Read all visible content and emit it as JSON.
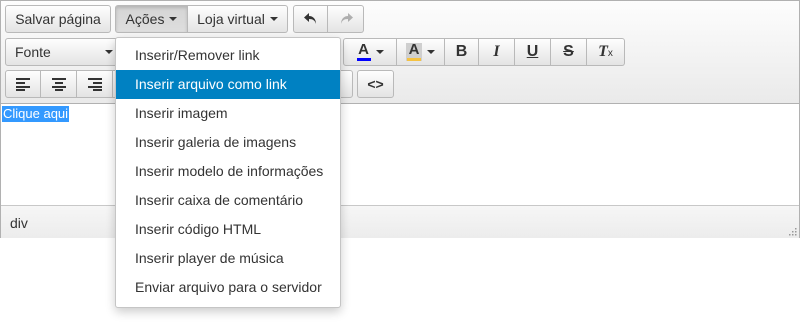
{
  "toolbar": {
    "save_label": "Salvar página",
    "actions_label": "Ações",
    "store_label": "Loja virtual",
    "font_label": "Fonte"
  },
  "icons": {
    "undo": "undo-icon",
    "redo": "redo-icon",
    "text_color": "text-color-icon",
    "bg_color": "background-color-icon",
    "bold": "bold-icon",
    "italic": "italic-icon",
    "underline": "underline-icon",
    "strike": "strikethrough-icon",
    "clear": "clear-formatting-icon",
    "align_left": "align-left-icon",
    "align_center": "align-center-icon",
    "align_right": "align-right-icon",
    "code": "code-icon"
  },
  "colors": {
    "text_color_swatch": "#0000ff",
    "bg_color_swatch": "#f5c242",
    "menu_highlight": "#0081c2",
    "selection": "#3399ff"
  },
  "glyphs": {
    "text_color": "A",
    "bg_color": "A",
    "bold": "B",
    "italic": "I",
    "underline": "U",
    "strike": "S",
    "clear": "T",
    "clear_sub": "x",
    "code": "<>"
  },
  "content": {
    "selected_text": "Clique aqui"
  },
  "status": {
    "path": "div"
  },
  "menu": {
    "items": [
      {
        "label": "Inserir/Remover link"
      },
      {
        "label": "Inserir arquivo como link"
      },
      {
        "label": "Inserir imagem"
      },
      {
        "label": "Inserir galeria de imagens"
      },
      {
        "label": "Inserir modelo de informações"
      },
      {
        "label": "Inserir caixa de comentário"
      },
      {
        "label": "Inserir código HTML"
      },
      {
        "label": "Inserir player de música"
      },
      {
        "label": "Enviar arquivo para o servidor"
      }
    ]
  }
}
